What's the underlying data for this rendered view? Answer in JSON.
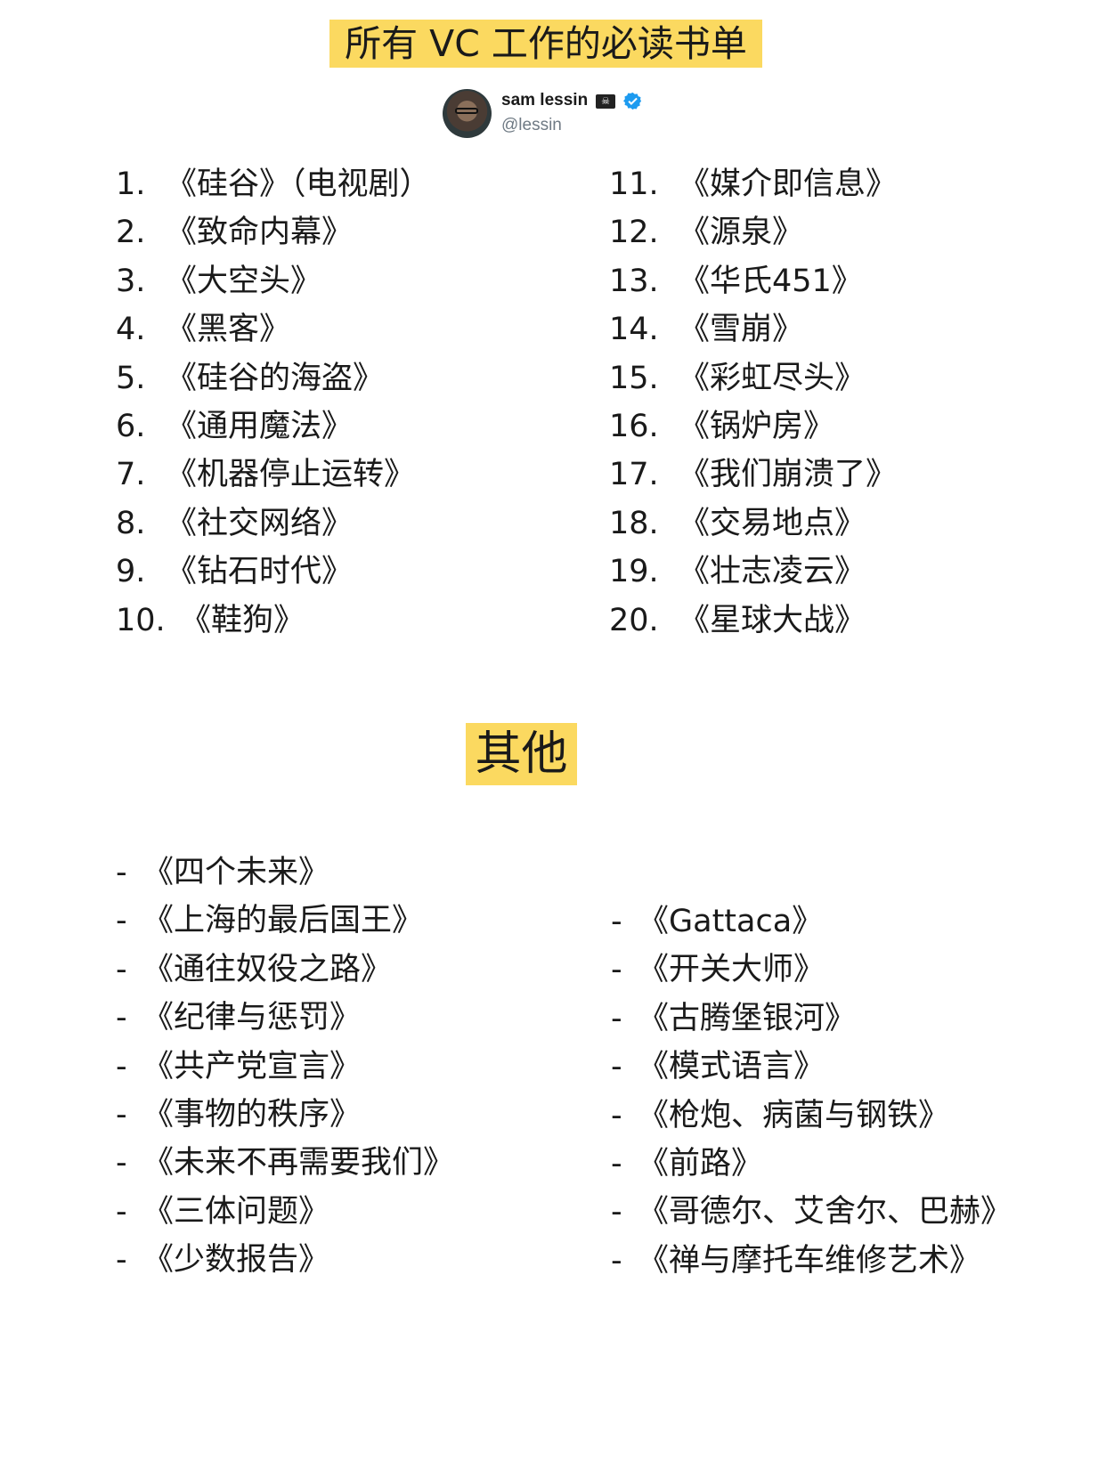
{
  "title": "所有 VC 工作的必读书单",
  "author": {
    "name": "sam lessin",
    "handle": "@lessin",
    "icons": [
      "pirate-flag-icon",
      "verified-badge-icon"
    ],
    "verified_color": "#1d9bf0"
  },
  "colors": {
    "highlight": "#fbd960",
    "text": "#1a1a1a"
  },
  "main_list": {
    "left": [
      {
        "num": "1.",
        "title": "《硅谷》（电视剧）"
      },
      {
        "num": "2.",
        "title": "《致命内幕》"
      },
      {
        "num": "3.",
        "title": "《大空头》"
      },
      {
        "num": "4.",
        "title": "《黑客》"
      },
      {
        "num": "5.",
        "title": "《硅谷的海盗》"
      },
      {
        "num": "6.",
        "title": "《通用魔法》"
      },
      {
        "num": "7.",
        "title": "《机器停止运转》"
      },
      {
        "num": "8.",
        "title": "《社交网络》"
      },
      {
        "num": "9.",
        "title": "《钻石时代》"
      },
      {
        "num": "10.",
        "title": "《鞋狗》"
      }
    ],
    "right": [
      {
        "num": "11.",
        "title": "《媒介即信息》"
      },
      {
        "num": "12.",
        "title": "《源泉》"
      },
      {
        "num": "13.",
        "title": "《华氏451》"
      },
      {
        "num": "14.",
        "title": "《雪崩》"
      },
      {
        "num": "15.",
        "title": "《彩虹尽头》"
      },
      {
        "num": "16.",
        "title": "《锅炉房》"
      },
      {
        "num": "17.",
        "title": "《我们崩溃了》"
      },
      {
        "num": "18.",
        "title": "《交易地点》"
      },
      {
        "num": "19.",
        "title": "《壮志凌云》"
      },
      {
        "num": "20.",
        "title": "《星球大战》"
      }
    ]
  },
  "others": {
    "heading": "其他",
    "bullet": "-",
    "left": [
      "《四个未来》",
      "《上海的最后国王》",
      "《通往奴役之路》",
      "《纪律与惩罚》",
      "《共产党宣言》",
      "《事物的秩序》",
      "《未来不再需要我们》",
      "《三体问题》",
      "《少数报告》"
    ],
    "right": [
      "《Gattaca》",
      "《开关大师》",
      "《古腾堡银河》",
      "《模式语言》",
      "《枪炮、病菌与钢铁》",
      "《前路》",
      "《哥德尔、艾舍尔、巴赫》",
      "《禅与摩托车维修艺术》"
    ]
  }
}
